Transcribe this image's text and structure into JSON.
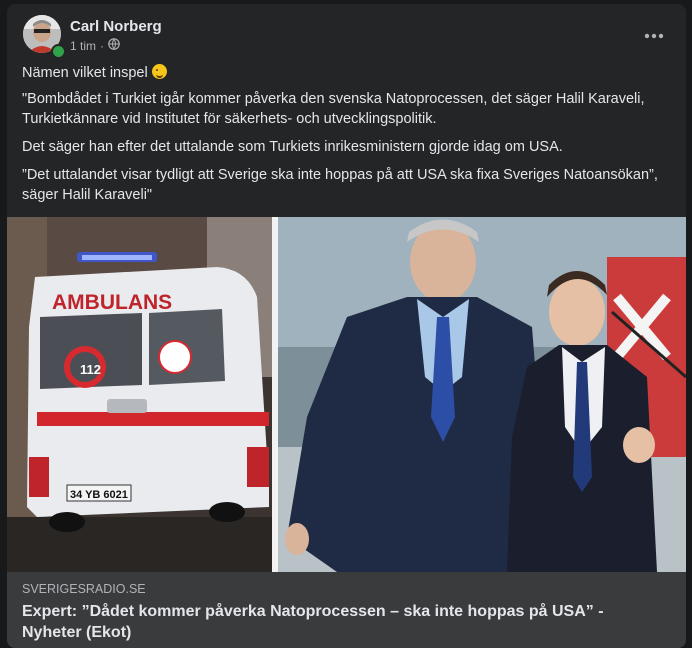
{
  "post": {
    "author": "Carl Norberg",
    "time": "1 tim",
    "separator": "·",
    "privacy_icon": "globe-icon",
    "more_icon": "more-options-icon",
    "paragraphs": [
      "Nämen vilket inspel",
      "\"Bombdådet i Turkiet igår kommer påverka den svenska Natoprocessen, det säger Halil Karaveli, Turkietkännare vid Institutet för säkerhets- och utvecklingspolitik.",
      "Det säger han efter det uttalande som Turkiets inrikesministern gjorde idag om USA.",
      "”Det uttalandet visar tydligt att Sverige ska inte hoppas på att USA ska fixa Sveriges Natoansökan”, säger Halil Karaveli\""
    ],
    "emoji": "winking-face-emoji"
  },
  "media": {
    "left_photo": {
      "ambulance_text": "AMBULANS",
      "number": "112",
      "plate": "34 YB 6021"
    }
  },
  "link": {
    "domain": "SVERIGESRADIO.SE",
    "title": "Expert: ”Dådet kommer påverka Natoprocessen – ska inte hoppas på USA” - Nyheter (Ekot)"
  },
  "colors": {
    "card_bg": "#242526",
    "link_bg": "#3a3b3c",
    "text": "#e4e6eb",
    "secondary": "#b0b3b8",
    "online": "#31a24c"
  }
}
